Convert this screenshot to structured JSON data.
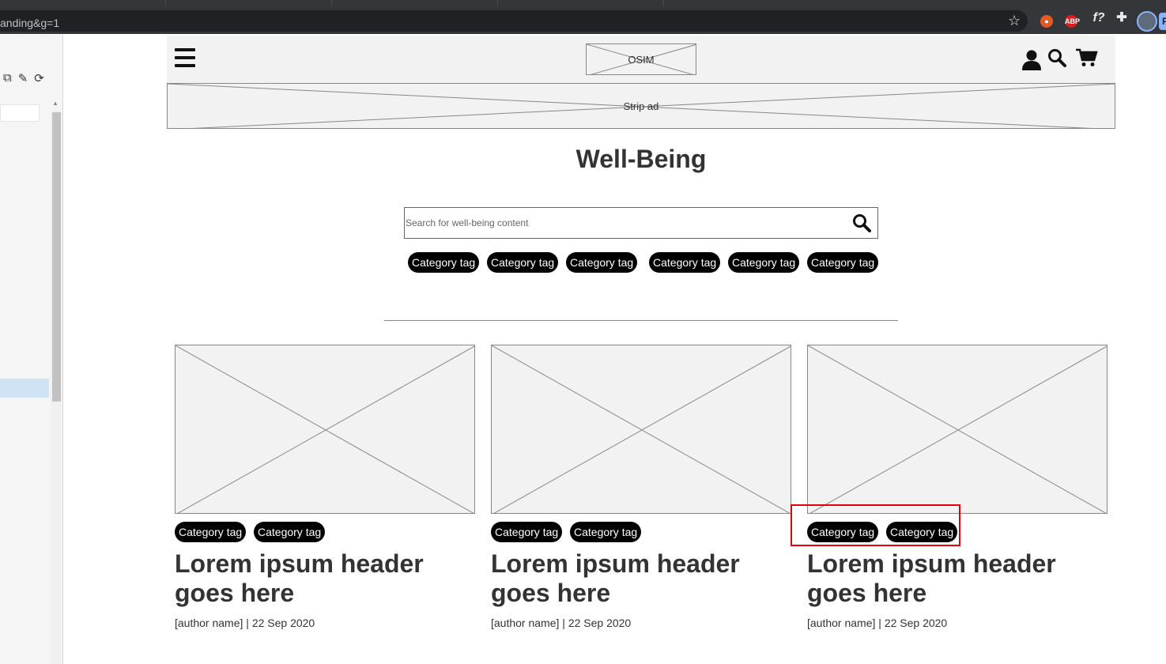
{
  "browser": {
    "url_fragment": "anding&g=1",
    "extensions": [
      "fox-extension-icon",
      "adblock-plus-icon",
      "font-finder-icon",
      "puzzle-icon",
      "profile-avatar"
    ],
    "abp_label": "ABP",
    "f_label": "f?",
    "p_label": "P"
  },
  "header": {
    "logo_text": "OSIM"
  },
  "strip_ad": {
    "label": "Strip ad"
  },
  "page": {
    "title": "Well-Being"
  },
  "search": {
    "placeholder": "Search for well-being content"
  },
  "category_tags": [
    "Category tag",
    "Category tag",
    "Category tag",
    "Category tag",
    "Category tag",
    "Category tag"
  ],
  "cards": [
    {
      "tags": [
        "Category tag",
        "Category tag"
      ],
      "title": "Lorem ipsum header goes here",
      "author": "[author name]",
      "separator": "|",
      "date": "22 Sep 2020"
    },
    {
      "tags": [
        "Category tag",
        "Category tag"
      ],
      "title": "Lorem ipsum header goes here",
      "author": "[author name]",
      "separator": "|",
      "date": "22 Sep 2020"
    },
    {
      "tags": [
        "Category tag",
        "Category tag"
      ],
      "title": "Lorem ipsum header goes here",
      "author": "[author name]",
      "separator": "|",
      "date": "22 Sep 2020"
    }
  ],
  "colors": {
    "placeholder_fill": "#f2f2f2",
    "tag_background": "#000000",
    "highlight_border": "#e8000b",
    "text": "#333333"
  }
}
